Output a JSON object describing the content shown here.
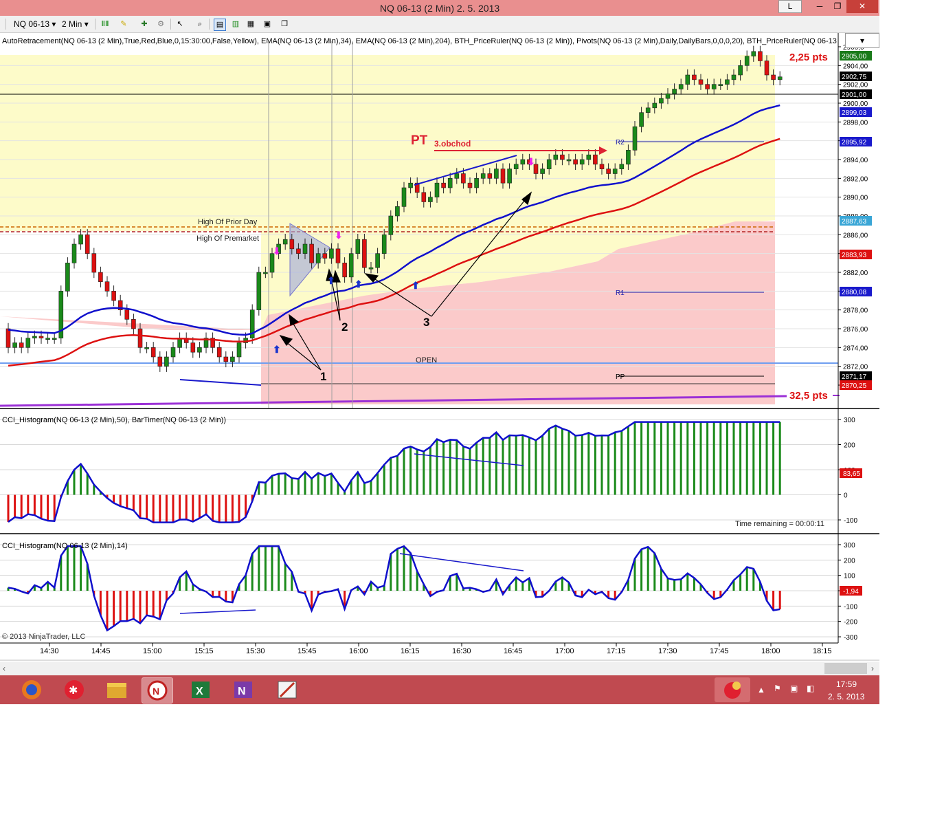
{
  "window": {
    "title": "NQ 06-13 (2 Min)  2. 5. 2013",
    "btn_l": "L",
    "btn_min": "─",
    "btn_max": "❐",
    "btn_close": "✕"
  },
  "toolbar": {
    "instrument": "NQ 06-13",
    "period": "2 Min",
    "dropdown": "▾"
  },
  "panel1": {
    "header": "AutoRetracement(NQ 06-13 (2 Min),True,Red,Blue,0,15:30:00,False,Yellow), EMA(NQ 06-13 (2 Min),34), EMA(NQ 06-13 (2 Min),204), BTH_PriceRuler(NQ 06-13 (2 Min)), Pivots(NQ 06-13 (2 Min),Daily,DailyBars,0,0,0,20), BTH_PriceRuler(NQ 06-13",
    "price_ticks": [
      "2906,0",
      "2904,00",
      "2902,00",
      "2900,00",
      "2898,00",
      "2896,00",
      "2894,00",
      "2892,00",
      "2890,00",
      "2888,00",
      "2886,00",
      "2884,00",
      "2882,00",
      "2880,00",
      "2878,00",
      "2876,00",
      "2874,00",
      "2872,00",
      "2870,00"
    ],
    "price_tags": [
      {
        "label": "2905,00",
        "color": "#1a7a1a"
      },
      {
        "label": "2902,75",
        "color": "#000000"
      },
      {
        "label": "2901,00",
        "color": "#000000"
      },
      {
        "label": "2899,03",
        "color": "#1a1acc"
      },
      {
        "label": "2895,92",
        "color": "#1a1acc"
      },
      {
        "label": "2887,63",
        "color": "#3aa6d6"
      },
      {
        "label": "2883,93",
        "color": "#dd1111"
      },
      {
        "label": "2880,08",
        "color": "#1a1acc"
      },
      {
        "label": "2871,17",
        "color": "#000000"
      },
      {
        "label": "2870,25",
        "color": "#dd1111"
      }
    ],
    "labels": {
      "pts_top": "2,25 pts",
      "pts_bottom": "32,5 pts",
      "pt": "PT",
      "obchod": "3.obchod",
      "high_prior_day": "High Of Prior Day",
      "high_premarket": "High Of Premarket",
      "open": "OPEN",
      "r2": "R2",
      "r1": "R1",
      "pp": "PP",
      "n1": "1",
      "n2": "2",
      "n3": "3"
    }
  },
  "panel2": {
    "header": "CCI_Histogram(NQ 06-13 (2 Min),50), BarTimer(NQ 06-13 (2 Min))",
    "ticks": [
      "300",
      "200",
      "100",
      "0",
      "-100"
    ],
    "tag": "83,65",
    "timer": "Time remaining = 00:00:11"
  },
  "panel3": {
    "header": "CCI_Histogram(NQ 06-13 (2 Min),14)",
    "ticks": [
      "300",
      "200",
      "100",
      "0",
      "-100",
      "-200",
      "-300"
    ],
    "tag": "-1,94",
    "copyright": "© 2013 NinjaTrader, LLC"
  },
  "time_axis": [
    "14:30",
    "14:45",
    "15:00",
    "15:15",
    "15:30",
    "15:45",
    "16:00",
    "16:15",
    "16:30",
    "16:45",
    "17:00",
    "17:15",
    "17:30",
    "17:45",
    "18:00",
    "18:15"
  ],
  "colors": {
    "up": "#1a8a1a",
    "down": "#dd1111",
    "ema34": "#1010cc",
    "ema204": "#dd1111",
    "titlebar": "#e98f8f",
    "taskbar": "#c04a50"
  },
  "taskbar": {
    "icons": [
      "firefox-icon",
      "app-red-icon",
      "file-manager-icon",
      "ninjatrader-icon",
      "excel-icon",
      "onenote-icon",
      "paint-icon"
    ],
    "clock_time": "17:59",
    "clock_date": "2. 5. 2013"
  }
}
